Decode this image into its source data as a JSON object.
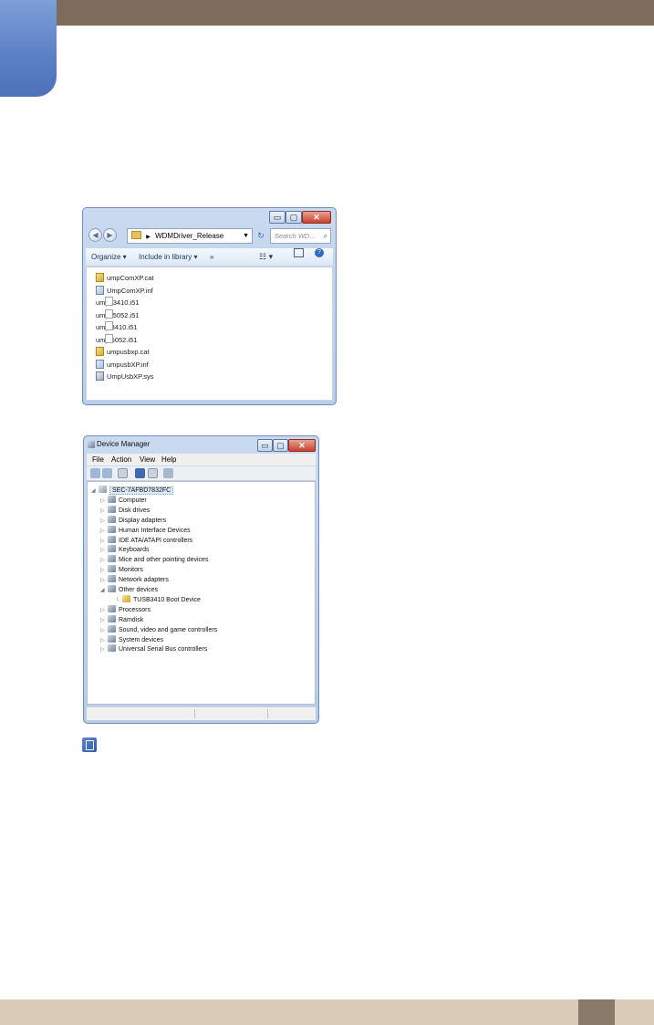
{
  "explorer": {
    "address": "WDMDriver_Release",
    "search_placeholder": "Search WD...",
    "toolbar": {
      "organize": "Organize ▾",
      "include": "Include in library ▾",
      "more": "»"
    },
    "files": [
      {
        "name": "umpComXP.cat",
        "type": "cat"
      },
      {
        "name": "UmpComXP.inf",
        "type": "inf"
      },
      {
        "name": "umpe3410.i51",
        "type": "file"
      },
      {
        "name": "umpe5052.i51",
        "type": "file"
      },
      {
        "name": "umpf3410.i51",
        "type": "file"
      },
      {
        "name": "umpf5052.i51",
        "type": "file"
      },
      {
        "name": "umpusbxp.cat",
        "type": "cat"
      },
      {
        "name": "umpusbXP.inf",
        "type": "inf"
      },
      {
        "name": "UmpUsbXP.sys",
        "type": "sys"
      }
    ]
  },
  "devmgr": {
    "title": "Device Manager",
    "menu": [
      "File",
      "Action",
      "View",
      "Help"
    ],
    "root": "SEC-7AFBD7832FC",
    "nodes": [
      "Computer",
      "Disk drives",
      "Display adapters",
      "Human Interface Devices",
      "IDE ATA/ATAPI controllers",
      "Keyboards",
      "Mice and other pointing devices",
      "Monitors",
      "Network adapters",
      "Other devices",
      "TUSB3410 Boot Device",
      "Processors",
      "Ramdisk",
      "Sound, video and game controllers",
      "System devices",
      "Universal Serial Bus controllers"
    ]
  }
}
